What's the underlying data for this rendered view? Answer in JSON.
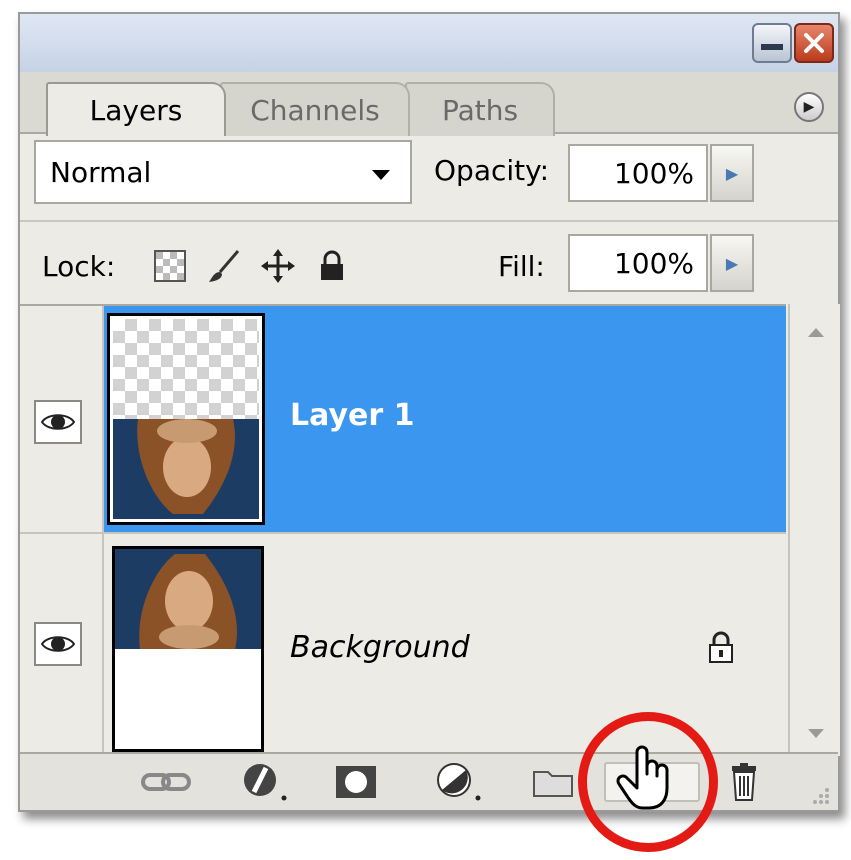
{
  "window": {
    "minimize_icon": "minimize-icon",
    "close_icon": "close-icon"
  },
  "tabs": [
    {
      "label": "Layers",
      "active": true
    },
    {
      "label": "Channels",
      "active": false
    },
    {
      "label": "Paths",
      "active": false
    }
  ],
  "blend": {
    "mode": "Normal",
    "opacity_label": "Opacity:",
    "opacity_value": "100%"
  },
  "lock": {
    "label": "Lock:",
    "icons": [
      "lock-transparent-icon",
      "lock-image-icon",
      "lock-position-icon",
      "lock-all-icon"
    ],
    "fill_label": "Fill:",
    "fill_value": "100%"
  },
  "layers": [
    {
      "name": "Layer 1",
      "selected": true,
      "visible": true,
      "locked": false
    },
    {
      "name": "Background",
      "selected": false,
      "visible": true,
      "locked": true
    }
  ],
  "bottom_toolbar": {
    "icons": [
      "link-layers-icon",
      "layer-style-icon",
      "layer-mask-icon",
      "adjustment-layer-icon",
      "new-group-icon",
      "new-layer-icon",
      "delete-layer-icon"
    ],
    "highlighted": "new-layer-icon"
  },
  "colors": {
    "selection": "#3a96ee",
    "highlight_ring": "#e31b14"
  }
}
